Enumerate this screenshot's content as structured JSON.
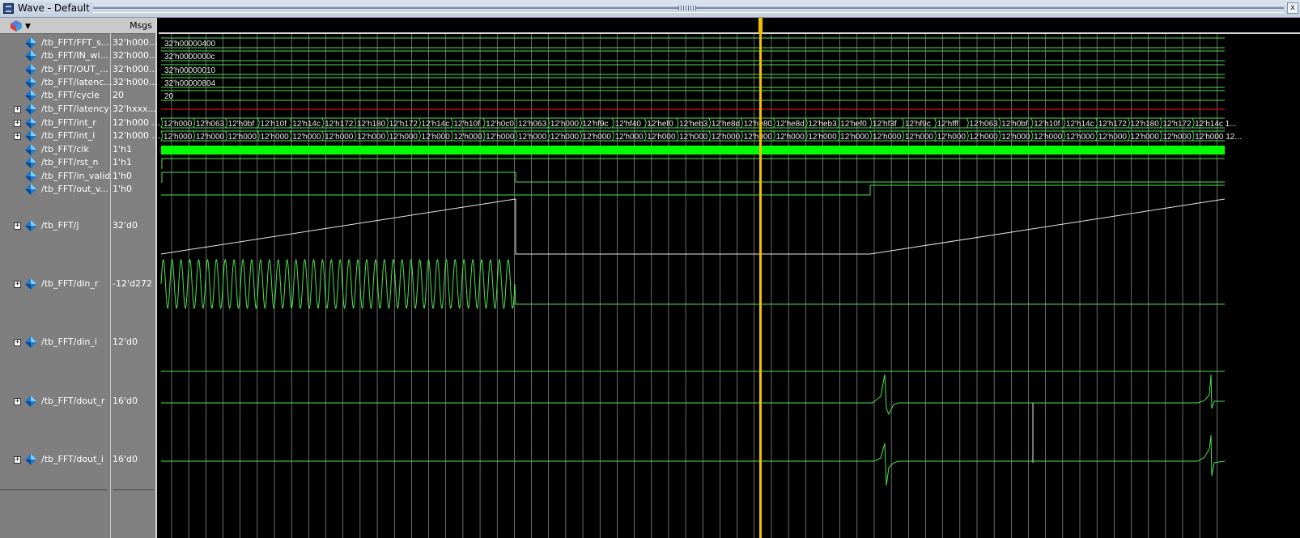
{
  "window": {
    "title": "Wave - Default",
    "pin_label": "x"
  },
  "columns": {
    "values_header": "Msgs"
  },
  "signals": [
    {
      "name": "/tb_FFT/FFT_s...",
      "value": "32'h000...",
      "expandable": false
    },
    {
      "name": "/tb_FFT/IN_wi...",
      "value": "32'h000...",
      "expandable": false
    },
    {
      "name": "/tb_FFT/OUT_...",
      "value": "32'h000...",
      "expandable": false
    },
    {
      "name": "/tb_FFT/latenc...",
      "value": "32'h000...",
      "expandable": false
    },
    {
      "name": "/tb_FFT/cycle",
      "value": "20",
      "expandable": false
    },
    {
      "name": "/tb_FFT/latency",
      "value": "32'hxxx...",
      "expandable": true
    },
    {
      "name": "/tb_FFT/int_r",
      "value": "12'h000 ...",
      "expandable": true
    },
    {
      "name": "/tb_FFT/int_i",
      "value": "12'h000 ...",
      "expandable": true
    },
    {
      "name": "/tb_FFT/clk",
      "value": "1'h1",
      "expandable": false
    },
    {
      "name": "/tb_FFT/rst_n",
      "value": "1'h1",
      "expandable": false
    },
    {
      "name": "/tb_FFT/in_valid",
      "value": "1'h0",
      "expandable": false
    },
    {
      "name": "/tb_FFT/out_v...",
      "value": "1'h0",
      "expandable": false
    },
    {
      "name": "/tb_FFT/j",
      "value": "32'd0",
      "expandable": true
    },
    {
      "name": "/tb_FFT/din_r",
      "value": "-12'd272",
      "expandable": true
    },
    {
      "name": "/tb_FFT/din_i",
      "value": "12'd0",
      "expandable": true
    },
    {
      "name": "/tb_FFT/dout_r",
      "value": "16'd0",
      "expandable": true
    },
    {
      "name": "/tb_FFT/dout_i",
      "value": "16'd0",
      "expandable": true
    }
  ],
  "wave_labels": {
    "fft_size": "32'h00000400",
    "in_width": "32'h0000000c",
    "out_width": "32'h00000010",
    "latency_const": "32'h00000804",
    "cycle": "20",
    "int_r": [
      "12'h000",
      "12'h063",
      "12'h0bf",
      "12'h10f",
      "12'h14c",
      "12'h172",
      "12'h180",
      "12'h172",
      "12'h14c",
      "12'h10f",
      "12'h0c0",
      "12'h063",
      "12'h000",
      "12'hf9c",
      "12'hf40",
      "12'hef0",
      "12'heb3",
      "12'he8d",
      "12'he80",
      "12'he8d",
      "12'heb3",
      "12'hef0",
      "12'hf3f",
      "12'hf9c",
      "12'hfff",
      "12'h063",
      "12'h0bf",
      "12'h10f",
      "12'h14c",
      "12'h172",
      "12'h180",
      "12'h172",
      "12'h14c 1..."
    ],
    "int_i": [
      "12'h000",
      "12'h000",
      "12'h000",
      "12'h000",
      "12'h000",
      "12'h000",
      "12'h000",
      "12'h000",
      "12'h000",
      "12'h000",
      "12'h000",
      "12'h000",
      "12'h000",
      "12'h000",
      "12'h000",
      "12'h000",
      "12'h000",
      "12'h000",
      "12'h000",
      "12'h000",
      "12'h000",
      "12'h000",
      "12'h000",
      "12'h000",
      "12'h000",
      "12'h000",
      "12'h000",
      "12'h000",
      "12'h000",
      "12'h000",
      "12'h000",
      "12'h000",
      "12'h000 12..."
    ]
  },
  "colors": {
    "wave_green": "#4ee04e",
    "clk_fill": "#00ff00",
    "latency_red": "#d01010",
    "cursor": "#f0c000",
    "grid": "#d0d0d0",
    "background": "#000000"
  }
}
